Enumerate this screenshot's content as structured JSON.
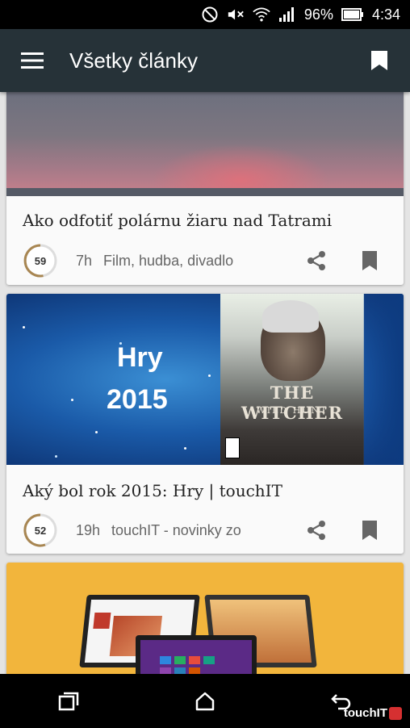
{
  "status": {
    "battery": "96%",
    "time": "4:34"
  },
  "appbar": {
    "title": "Všetky články"
  },
  "cards": [
    {
      "title": "Ako odfotiť polárnu žiaru nad Tatrami",
      "score": "59",
      "time": "7h",
      "source": "Film, hudba, divadlo"
    },
    {
      "title": "Aký bol rok 2015: Hry | touchIT",
      "score": "52",
      "time": "19h",
      "source": "touchIT - novinky zo",
      "image_text_1": "Hry",
      "image_text_2": "2015",
      "cover_title": "THE WITCHER",
      "cover_sub": "WILD HUNT"
    }
  ],
  "watermark": "touchIT"
}
